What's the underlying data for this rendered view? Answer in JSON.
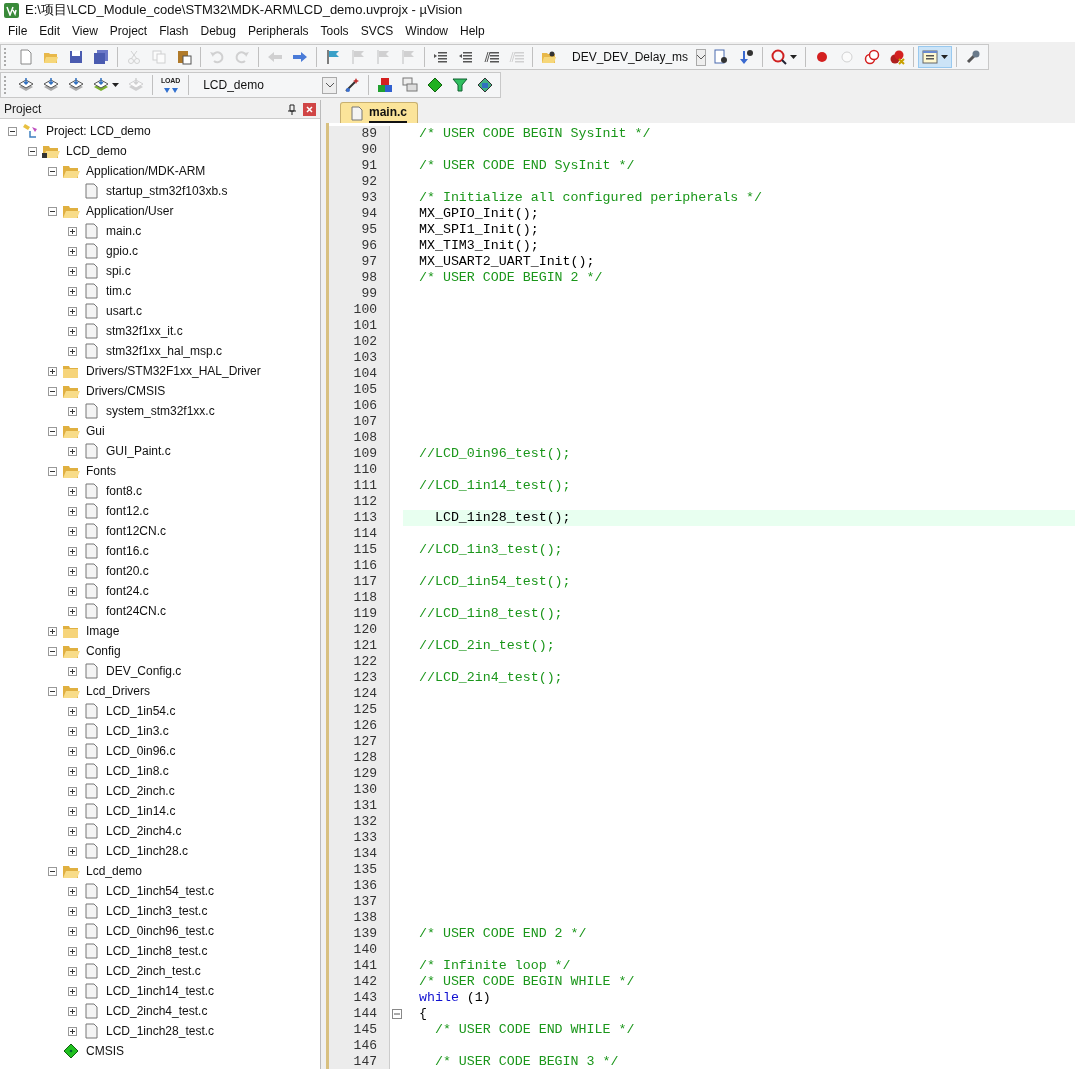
{
  "window": {
    "title": "E:\\项目\\LCD_Module_code\\STM32\\MDK-ARM\\LCD_demo.uvprojx - µVision"
  },
  "menu": [
    "File",
    "Edit",
    "View",
    "Project",
    "Flash",
    "Debug",
    "Peripherals",
    "Tools",
    "SVCS",
    "Window",
    "Help"
  ],
  "toolbar_1": [
    {
      "kind": "new",
      "disabled": false
    },
    {
      "kind": "open",
      "disabled": false
    },
    {
      "kind": "save",
      "disabled": false
    },
    {
      "kind": "save_all",
      "disabled": false
    },
    {
      "kind": "separator"
    },
    {
      "kind": "cut",
      "disabled": true
    },
    {
      "kind": "copy",
      "disabled": true
    },
    {
      "kind": "paste",
      "disabled": false
    },
    {
      "kind": "separator"
    },
    {
      "kind": "undo",
      "disabled": true
    },
    {
      "kind": "redo",
      "disabled": true
    },
    {
      "kind": "separator"
    },
    {
      "kind": "back",
      "disabled": true
    },
    {
      "kind": "forward",
      "disabled": false
    },
    {
      "kind": "separator"
    },
    {
      "kind": "bookmark",
      "disabled": false
    },
    {
      "kind": "bookmark_prev",
      "disabled": true
    },
    {
      "kind": "bookmark_next",
      "disabled": true
    },
    {
      "kind": "bookmark_clear",
      "disabled": true
    },
    {
      "kind": "separator"
    },
    {
      "kind": "indent",
      "disabled": false
    },
    {
      "kind": "unindent",
      "disabled": false
    },
    {
      "kind": "comment",
      "disabled": false
    },
    {
      "kind": "uncomment",
      "disabled": true
    },
    {
      "kind": "separator"
    },
    {
      "kind": "find_in_files",
      "disabled": false
    },
    {
      "kind": "combo",
      "value": "DEV_DEV_Delay_ms"
    },
    {
      "kind": "find",
      "disabled": false
    },
    {
      "kind": "incremental_find",
      "disabled": false
    },
    {
      "kind": "separator"
    },
    {
      "kind": "debug",
      "disabled": false
    },
    {
      "kind": "separator"
    },
    {
      "kind": "breakpoint",
      "disabled": false
    },
    {
      "kind": "breakpoint_toggle",
      "disabled": true
    },
    {
      "kind": "breakpoint_all",
      "disabled": false
    },
    {
      "kind": "breakpoint_kill",
      "disabled": false
    },
    {
      "kind": "separator"
    },
    {
      "kind": "windows",
      "disabled": false,
      "selected": true
    },
    {
      "kind": "separator"
    },
    {
      "kind": "configure",
      "disabled": false
    }
  ],
  "toolbar_2": [
    {
      "kind": "translate",
      "disabled": false
    },
    {
      "kind": "build",
      "disabled": false
    },
    {
      "kind": "rebuild",
      "disabled": false
    },
    {
      "kind": "batch_build",
      "disabled": false
    },
    {
      "kind": "stop_build",
      "disabled": true
    },
    {
      "kind": "separator"
    },
    {
      "kind": "download",
      "label": "LOAD",
      "disabled": false
    },
    {
      "kind": "separator"
    },
    {
      "kind": "combo",
      "value": "LCD_demo"
    },
    {
      "kind": "options",
      "disabled": false
    },
    {
      "kind": "separator"
    },
    {
      "kind": "manage_components",
      "disabled": false
    },
    {
      "kind": "multi_project",
      "disabled": false
    },
    {
      "kind": "rte",
      "disabled": false
    },
    {
      "kind": "packs",
      "disabled": false
    },
    {
      "kind": "pack_installer",
      "disabled": false
    }
  ],
  "project_panel": {
    "title": "Project",
    "tree": [
      {
        "kind": "project",
        "label": "Project: LCD_demo",
        "expanded": true,
        "children": [
          {
            "kind": "target",
            "label": "LCD_demo",
            "expanded": true,
            "children": [
              {
                "kind": "group",
                "label": "Application/MDK-ARM",
                "expanded": true,
                "children": [
                  {
                    "kind": "file",
                    "label": "startup_stm32f103xb.s",
                    "expandable": false
                  }
                ]
              },
              {
                "kind": "group",
                "label": "Application/User",
                "expanded": true,
                "children": [
                  {
                    "kind": "file",
                    "label": "main.c",
                    "expandable": true
                  },
                  {
                    "kind": "file",
                    "label": "gpio.c",
                    "expandable": true
                  },
                  {
                    "kind": "file",
                    "label": "spi.c",
                    "expandable": true
                  },
                  {
                    "kind": "file",
                    "label": "tim.c",
                    "expandable": true
                  },
                  {
                    "kind": "file",
                    "label": "usart.c",
                    "expandable": true
                  },
                  {
                    "kind": "file",
                    "label": "stm32f1xx_it.c",
                    "expandable": true
                  },
                  {
                    "kind": "file",
                    "label": "stm32f1xx_hal_msp.c",
                    "expandable": true
                  }
                ]
              },
              {
                "kind": "group",
                "label": "Drivers/STM32F1xx_HAL_Driver",
                "expanded": false
              },
              {
                "kind": "group",
                "label": "Drivers/CMSIS",
                "expanded": true,
                "children": [
                  {
                    "kind": "file",
                    "label": "system_stm32f1xx.c",
                    "expandable": true
                  }
                ]
              },
              {
                "kind": "group",
                "label": "Gui",
                "expanded": true,
                "children": [
                  {
                    "kind": "file",
                    "label": "GUI_Paint.c",
                    "expandable": true
                  }
                ]
              },
              {
                "kind": "group",
                "label": "Fonts",
                "expanded": true,
                "children": [
                  {
                    "kind": "file",
                    "label": "font8.c",
                    "expandable": true
                  },
                  {
                    "kind": "file",
                    "label": "font12.c",
                    "expandable": true
                  },
                  {
                    "kind": "file",
                    "label": "font12CN.c",
                    "expandable": true
                  },
                  {
                    "kind": "file",
                    "label": "font16.c",
                    "expandable": true
                  },
                  {
                    "kind": "file",
                    "label": "font20.c",
                    "expandable": true
                  },
                  {
                    "kind": "file",
                    "label": "font24.c",
                    "expandable": true
                  },
                  {
                    "kind": "file",
                    "label": "font24CN.c",
                    "expandable": true
                  }
                ]
              },
              {
                "kind": "group",
                "label": "Image",
                "expanded": false
              },
              {
                "kind": "group",
                "label": "Config",
                "expanded": true,
                "children": [
                  {
                    "kind": "file",
                    "label": "DEV_Config.c",
                    "expandable": true
                  }
                ]
              },
              {
                "kind": "group",
                "label": "Lcd_Drivers",
                "expanded": true,
                "children": [
                  {
                    "kind": "file",
                    "label": "LCD_1in54.c",
                    "expandable": true
                  },
                  {
                    "kind": "file",
                    "label": "LCD_1in3.c",
                    "expandable": true
                  },
                  {
                    "kind": "file",
                    "label": "LCD_0in96.c",
                    "expandable": true
                  },
                  {
                    "kind": "file",
                    "label": "LCD_1in8.c",
                    "expandable": true
                  },
                  {
                    "kind": "file",
                    "label": "LCD_2inch.c",
                    "expandable": true
                  },
                  {
                    "kind": "file",
                    "label": "LCD_1in14.c",
                    "expandable": true
                  },
                  {
                    "kind": "file",
                    "label": "LCD_2inch4.c",
                    "expandable": true
                  },
                  {
                    "kind": "file",
                    "label": "LCD_1inch28.c",
                    "expandable": true
                  }
                ]
              },
              {
                "kind": "group",
                "label": "Lcd_demo",
                "expanded": true,
                "children": [
                  {
                    "kind": "file",
                    "label": "LCD_1inch54_test.c",
                    "expandable": true
                  },
                  {
                    "kind": "file",
                    "label": "LCD_1inch3_test.c",
                    "expandable": true
                  },
                  {
                    "kind": "file",
                    "label": "LCD_0inch96_test.c",
                    "expandable": true
                  },
                  {
                    "kind": "file",
                    "label": "LCD_1inch8_test.c",
                    "expandable": true
                  },
                  {
                    "kind": "file",
                    "label": "LCD_2inch_test.c",
                    "expandable": true
                  },
                  {
                    "kind": "file",
                    "label": "LCD_1inch14_test.c",
                    "expandable": true
                  },
                  {
                    "kind": "file",
                    "label": "LCD_2inch4_test.c",
                    "expandable": true
                  },
                  {
                    "kind": "file",
                    "label": "LCD_1inch28_test.c",
                    "expandable": true
                  }
                ]
              },
              {
                "kind": "component",
                "label": "CMSIS"
              }
            ]
          }
        ]
      }
    ]
  },
  "editor": {
    "tabs": [
      {
        "label": "main.c",
        "selected": true
      }
    ],
    "lines": [
      {
        "number": "89",
        "highlighted": false,
        "segments": [
          {
            "kind": "comment",
            "text": "  /* USER CODE BEGIN SysInit */"
          }
        ]
      },
      {
        "number": "90",
        "highlighted": false
      },
      {
        "number": "91",
        "highlighted": false,
        "segments": [
          {
            "kind": "comment",
            "text": "  /* USER CODE END SysInit */"
          }
        ]
      },
      {
        "number": "92",
        "highlighted": false
      },
      {
        "number": "93",
        "highlighted": false,
        "segments": [
          {
            "kind": "comment",
            "text": "  /* Initialize all configured peripherals */"
          }
        ]
      },
      {
        "number": "94",
        "highlighted": false,
        "segments": [
          {
            "kind": "code",
            "text": "  MX_GPIO_Init();"
          }
        ]
      },
      {
        "number": "95",
        "highlighted": false,
        "segments": [
          {
            "kind": "code",
            "text": "  MX_SPI1_Init();"
          }
        ]
      },
      {
        "number": "96",
        "highlighted": false,
        "segments": [
          {
            "kind": "code",
            "text": "  MX_TIM3_Init();"
          }
        ]
      },
      {
        "number": "97",
        "highlighted": false,
        "segments": [
          {
            "kind": "code",
            "text": "  MX_USART2_UART_Init();"
          }
        ]
      },
      {
        "number": "98",
        "highlighted": false,
        "segments": [
          {
            "kind": "comment",
            "text": "  /* USER CODE BEGIN 2 */"
          }
        ]
      },
      {
        "number": "99",
        "highlighted": false
      },
      {
        "number": "100",
        "highlighted": false
      },
      {
        "number": "101",
        "highlighted": false
      },
      {
        "number": "102",
        "highlighted": false
      },
      {
        "number": "103",
        "highlighted": false
      },
      {
        "number": "104",
        "highlighted": false
      },
      {
        "number": "105",
        "highlighted": false
      },
      {
        "number": "106",
        "highlighted": false
      },
      {
        "number": "107",
        "highlighted": false
      },
      {
        "number": "108",
        "highlighted": false
      },
      {
        "number": "109",
        "highlighted": false,
        "segments": [
          {
            "kind": "comment",
            "text": "  //LCD_0in96_test();"
          }
        ]
      },
      {
        "number": "110",
        "highlighted": false
      },
      {
        "number": "111",
        "highlighted": false,
        "segments": [
          {
            "kind": "comment",
            "text": "  //LCD_1in14_test();"
          }
        ]
      },
      {
        "number": "112",
        "highlighted": false
      },
      {
        "number": "113",
        "highlighted": true,
        "segments": [
          {
            "kind": "code",
            "text": "    LCD_1in28_test();"
          }
        ]
      },
      {
        "number": "114",
        "highlighted": false
      },
      {
        "number": "115",
        "highlighted": false,
        "segments": [
          {
            "kind": "comment",
            "text": "  //LCD_1in3_test();"
          }
        ]
      },
      {
        "number": "116",
        "highlighted": false
      },
      {
        "number": "117",
        "highlighted": false,
        "segments": [
          {
            "kind": "comment",
            "text": "  //LCD_1in54_test();"
          }
        ]
      },
      {
        "number": "118",
        "highlighted": false
      },
      {
        "number": "119",
        "highlighted": false,
        "segments": [
          {
            "kind": "comment",
            "text": "  //LCD_1in8_test();"
          }
        ]
      },
      {
        "number": "120",
        "highlighted": false
      },
      {
        "number": "121",
        "highlighted": false,
        "segments": [
          {
            "kind": "comment",
            "text": "  //LCD_2in_test();"
          }
        ]
      },
      {
        "number": "122",
        "highlighted": false
      },
      {
        "number": "123",
        "highlighted": false,
        "segments": [
          {
            "kind": "comment",
            "text": "  //LCD_2in4_test();"
          }
        ]
      },
      {
        "number": "124",
        "highlighted": false
      },
      {
        "number": "125",
        "highlighted": false
      },
      {
        "number": "126",
        "highlighted": false
      },
      {
        "number": "127",
        "highlighted": false
      },
      {
        "number": "128",
        "highlighted": false
      },
      {
        "number": "129",
        "highlighted": false
      },
      {
        "number": "130",
        "highlighted": false
      },
      {
        "number": "131",
        "highlighted": false
      },
      {
        "number": "132",
        "highlighted": false
      },
      {
        "number": "133",
        "highlighted": false
      },
      {
        "number": "134",
        "highlighted": false
      },
      {
        "number": "135",
        "highlighted": false
      },
      {
        "number": "136",
        "highlighted": false
      },
      {
        "number": "137",
        "highlighted": false
      },
      {
        "number": "138",
        "highlighted": false
      },
      {
        "number": "139",
        "highlighted": false,
        "segments": [
          {
            "kind": "comment",
            "text": "  /* USER CODE END 2 */"
          }
        ]
      },
      {
        "number": "140",
        "highlighted": false
      },
      {
        "number": "141",
        "highlighted": false,
        "segments": [
          {
            "kind": "comment",
            "text": "  /* Infinite loop */"
          }
        ]
      },
      {
        "number": "142",
        "highlighted": false,
        "segments": [
          {
            "kind": "comment",
            "text": "  /* USER CODE BEGIN WHILE */"
          }
        ]
      },
      {
        "number": "143",
        "highlighted": false,
        "segments": [
          {
            "kind": "keyword",
            "text": "  while"
          },
          {
            "kind": "code",
            "text": " (1)"
          }
        ]
      },
      {
        "number": "144",
        "highlighted": false,
        "fold_open": true,
        "segments": [
          {
            "kind": "code",
            "text": "  {"
          }
        ]
      },
      {
        "number": "145",
        "highlighted": false,
        "segments": [
          {
            "kind": "comment",
            "text": "    /* USER CODE END WHILE */"
          }
        ]
      },
      {
        "number": "146",
        "highlighted": false
      },
      {
        "number": "147",
        "highlighted": false,
        "segments": [
          {
            "kind": "comment",
            "text": "    /* USER CODE BEGIN 3 */"
          }
        ]
      }
    ]
  }
}
